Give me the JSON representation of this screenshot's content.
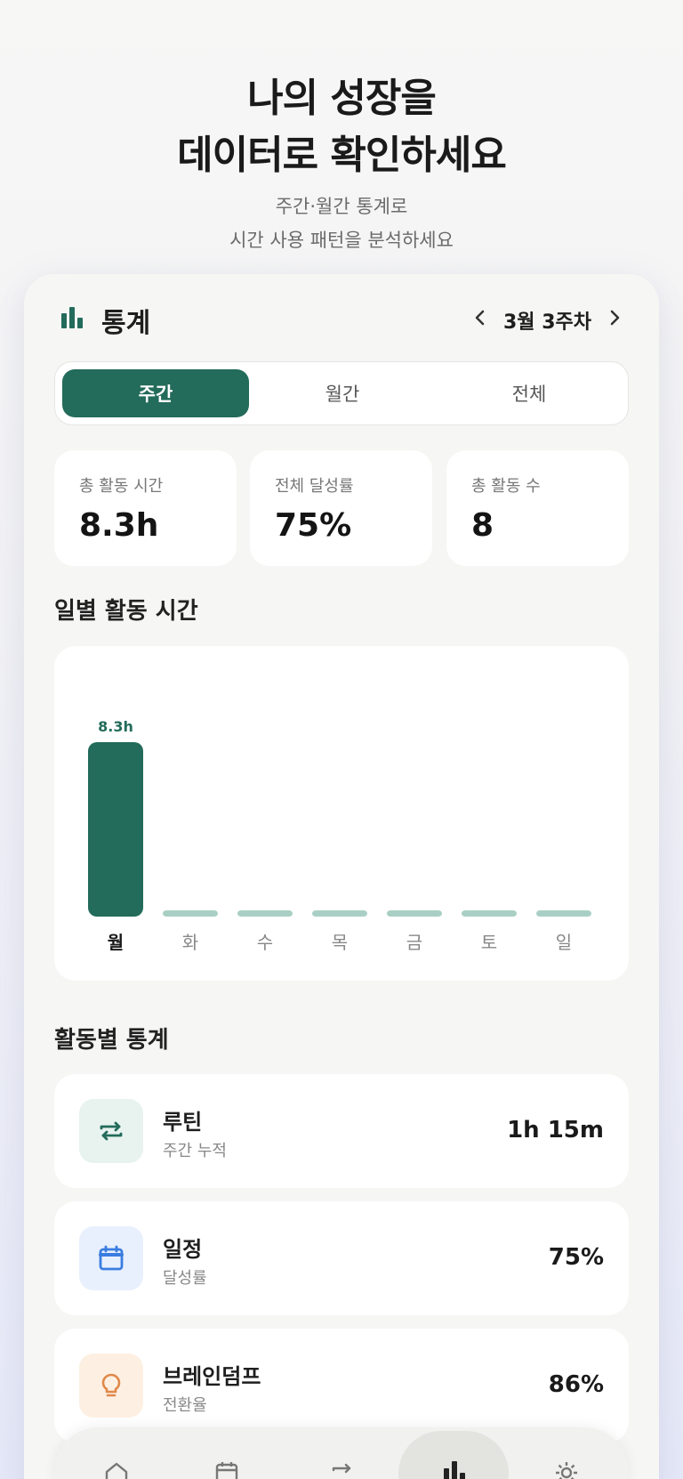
{
  "hero": {
    "title_line1": "나의 성장을",
    "title_line2": "데이터로 확인하세요",
    "subtitle_line1": "주간·월간 통계로",
    "subtitle_line2": "시간 사용 패턴을 분석하세요"
  },
  "header": {
    "title": "통계",
    "icon": "bar-chart-icon",
    "week_label": "3월 3주차",
    "prev_icon": "chevron-left-icon",
    "next_icon": "chevron-right-icon"
  },
  "segment": {
    "tabs": [
      "주간",
      "월간",
      "전체"
    ],
    "active_index": 0
  },
  "stats": [
    {
      "label": "총 활동 시간",
      "value": "8.3h"
    },
    {
      "label": "전체 달성률",
      "value": "75%"
    },
    {
      "label": "총 활동 수",
      "value": "8"
    }
  ],
  "daily_section": {
    "title": "일별 활동 시간"
  },
  "chart_data": {
    "type": "bar",
    "categories": [
      "월",
      "화",
      "수",
      "목",
      "금",
      "토",
      "일"
    ],
    "values": [
      8.3,
      0,
      0,
      0,
      0,
      0,
      0
    ],
    "data_labels": [
      "8.3h",
      "",
      "",
      "",
      "",
      "",
      ""
    ],
    "highlight_index": 0,
    "ylim": [
      0,
      8.3
    ],
    "title": "",
    "xlabel": "",
    "ylabel": "",
    "grid": false,
    "colors": {
      "active": "#236b5a",
      "empty": "#a9cfc4"
    }
  },
  "activity_section": {
    "title": "활동별 통계"
  },
  "activities": [
    {
      "name": "루틴",
      "sub": "주간 누적",
      "value": "1h 15m",
      "icon": "repeat-icon",
      "icon_color": "#236b5a",
      "bg": "#e8f3ef"
    },
    {
      "name": "일정",
      "sub": "달성률",
      "value": "75%",
      "icon": "calendar-icon",
      "icon_color": "#3b7de0",
      "bg": "#e8f0fd"
    },
    {
      "name": "브레인덤프",
      "sub": "전환율",
      "value": "86%",
      "icon": "lightbulb-icon",
      "icon_color": "#e0894a",
      "bg": "#fdf0e3"
    }
  ],
  "nav": {
    "items": [
      "home-icon",
      "calendar-icon",
      "repeat-icon",
      "bar-chart-icon",
      "settings-icon"
    ],
    "active_index": 3
  },
  "colors": {
    "accent": "#236b5a",
    "background": "#f6f6f4"
  }
}
